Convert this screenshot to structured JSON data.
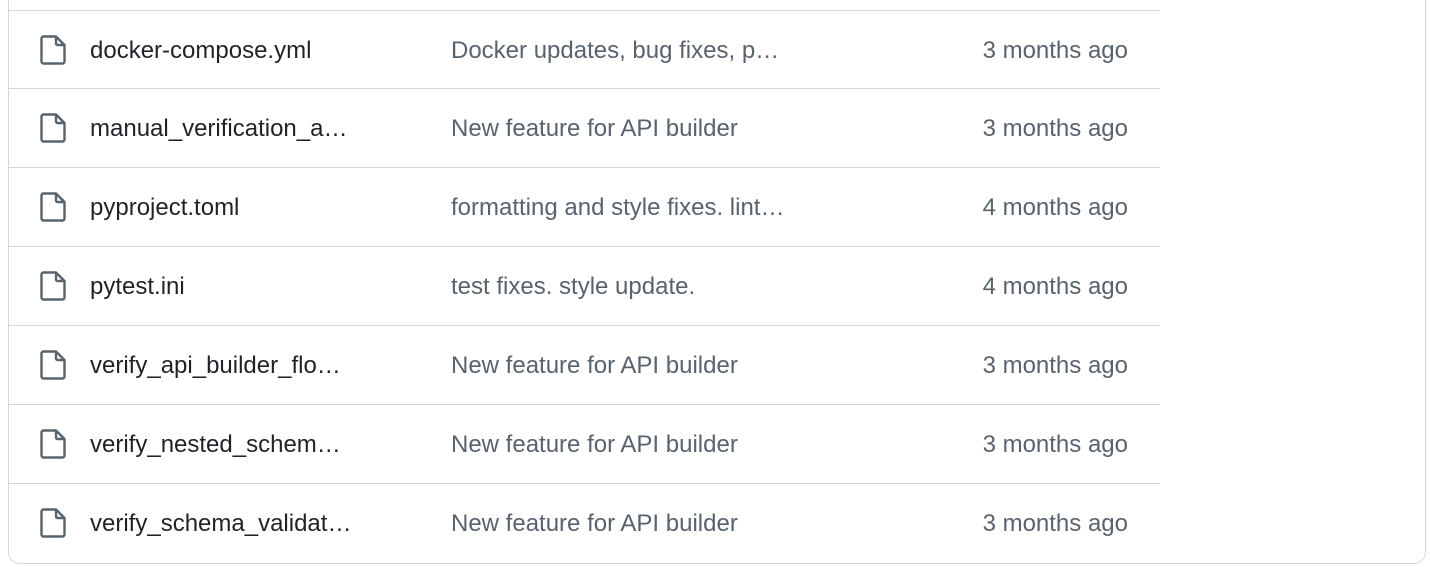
{
  "files": [
    {
      "icon": "file-icon",
      "name": "docker-compose.yml",
      "message": "Docker updates, bug fixes, p…",
      "date": "3 months ago"
    },
    {
      "icon": "file-icon",
      "name": "manual_verification_a…",
      "message": "New feature for API builder",
      "date": "3 months ago"
    },
    {
      "icon": "file-icon",
      "name": "pyproject.toml",
      "message": "formatting and style fixes. lint…",
      "date": "4 months ago"
    },
    {
      "icon": "file-icon",
      "name": "pytest.ini",
      "message": "test fixes. style update.",
      "date": "4 months ago"
    },
    {
      "icon": "file-icon",
      "name": "verify_api_builder_flo…",
      "message": "New feature for API builder",
      "date": "3 months ago"
    },
    {
      "icon": "file-icon",
      "name": "verify_nested_schem…",
      "message": "New feature for API builder",
      "date": "3 months ago"
    },
    {
      "icon": "file-icon",
      "name": "verify_schema_validat…",
      "message": "New feature for API builder",
      "date": "3 months ago"
    }
  ],
  "colors": {
    "border": "#d1d9e0",
    "text_primary": "#1f2328",
    "text_muted": "#59636e"
  }
}
